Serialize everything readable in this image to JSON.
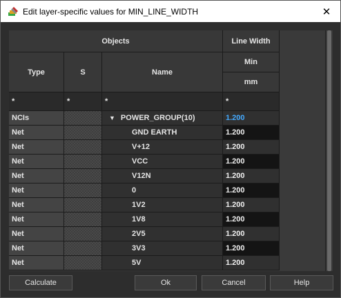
{
  "window": {
    "title": "Edit layer-specific values for MIN_LINE_WIDTH",
    "close_glyph": "✕"
  },
  "grid": {
    "group_headers": {
      "objects": "Objects",
      "line_width": "Line Width"
    },
    "columns": {
      "type": "Type",
      "s": "S",
      "name": "Name",
      "min": "Min",
      "unit": "mm"
    },
    "filters": {
      "type": "*",
      "s": "*",
      "name": "*",
      "value": "*"
    },
    "rows": [
      {
        "type": "NCIs",
        "s": "",
        "name": "POWER_GROUP(10)",
        "value": "1.200",
        "expanded": true,
        "value_color": "#44aaff"
      },
      {
        "type": "Net",
        "s": "",
        "name": "GND EARTH",
        "value": "1.200"
      },
      {
        "type": "Net",
        "s": "",
        "name": "V+12",
        "value": "1.200"
      },
      {
        "type": "Net",
        "s": "",
        "name": "VCC",
        "value": "1.200"
      },
      {
        "type": "Net",
        "s": "",
        "name": "V12N",
        "value": "1.200"
      },
      {
        "type": "Net",
        "s": "",
        "name": "0",
        "value": "1.200"
      },
      {
        "type": "Net",
        "s": "",
        "name": "1V2",
        "value": "1.200"
      },
      {
        "type": "Net",
        "s": "",
        "name": "1V8",
        "value": "1.200"
      },
      {
        "type": "Net",
        "s": "",
        "name": "2V5",
        "value": "1.200"
      },
      {
        "type": "Net",
        "s": "",
        "name": "3V3",
        "value": "1.200"
      },
      {
        "type": "Net",
        "s": "",
        "name": "5V",
        "value": "1.200"
      }
    ]
  },
  "buttons": {
    "calculate": "Calculate",
    "ok": "Ok",
    "cancel": "Cancel",
    "help": "Help"
  },
  "colors": {
    "accent": "#44aaff",
    "background": "#2d2d2d"
  }
}
